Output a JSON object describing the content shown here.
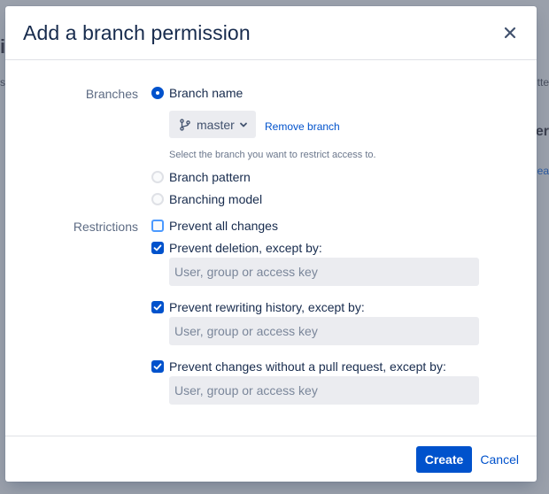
{
  "background": {
    "frag_left_title": "i",
    "frag_left_text": "s",
    "frag_right_text": "tte",
    "frag_right_heading": "er",
    "frag_right_link": "ea"
  },
  "modal": {
    "title": "Add a branch permission",
    "close_icon": "close-icon"
  },
  "branches": {
    "label": "Branches",
    "options": [
      {
        "label": "Branch name",
        "selected": true
      },
      {
        "label": "Branch pattern",
        "selected": false
      },
      {
        "label": "Branching model",
        "selected": false
      }
    ],
    "selected_branch": "master",
    "remove_link": "Remove branch",
    "helper": "Select the branch you want to restrict access to."
  },
  "restrictions": {
    "label": "Restrictions",
    "items": [
      {
        "label": "Prevent all changes",
        "checked": false
      },
      {
        "label": "Prevent deletion, except by:",
        "checked": true,
        "placeholder": "User, group or access key"
      },
      {
        "label": "Prevent rewriting history, except by:",
        "checked": true,
        "placeholder": "User, group or access key"
      },
      {
        "label": "Prevent changes without a pull request, except by:",
        "checked": true,
        "placeholder": "User, group or access key"
      }
    ]
  },
  "footer": {
    "create_label": "Create",
    "cancel_label": "Cancel"
  },
  "colors": {
    "primary": "#0052cc",
    "overlay": "#9aa0ab"
  }
}
